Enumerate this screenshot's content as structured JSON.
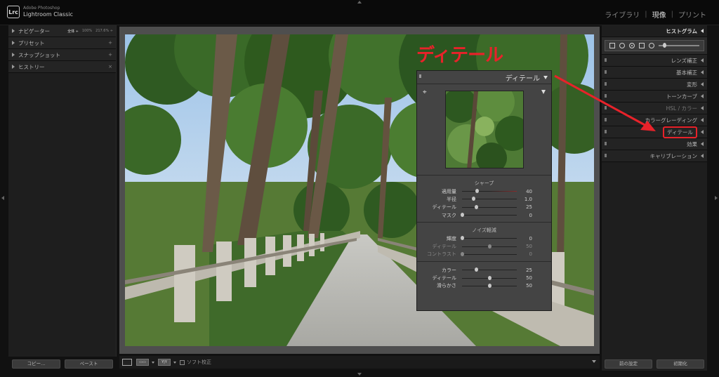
{
  "app": {
    "brand_line1": "Adobe Photoshop",
    "brand_line2": "Lightroom Classic",
    "logo": "Lrc"
  },
  "modules": {
    "library": "ライブラリ",
    "develop": "現像",
    "print": "プリント"
  },
  "left_panel": {
    "navigator": {
      "label": "ナビゲーター",
      "fit": "全体 ÷",
      "zoom1": "100%",
      "zoom2": "217.6% ÷"
    },
    "items": [
      {
        "label": "プリセット",
        "action": "+"
      },
      {
        "label": "スナップショット",
        "action": "+"
      },
      {
        "label": "ヒストリー",
        "action": "×"
      }
    ],
    "copy_button": "コピー...",
    "paste_button": "ペースト"
  },
  "toolbar": {
    "softproof_label": "ソフト校正",
    "box1": "▭▭",
    "box2": "Y|Y"
  },
  "right_panel": {
    "histogram": "ヒストグラム",
    "panels": [
      {
        "label": "レンズ補正"
      },
      {
        "label": "基本補正"
      },
      {
        "label": "変形"
      },
      {
        "label": "トーンカーブ"
      },
      {
        "label": "HSL / カラー"
      },
      {
        "label": "カラーグレーディング"
      },
      {
        "label": "ディテール"
      },
      {
        "label": "効果"
      },
      {
        "label": "キャリブレーション"
      }
    ],
    "highlighted": "ディテール",
    "prev_button": "前の設定",
    "reset_button": "初期化"
  },
  "annotation": {
    "title": "ディテール",
    "color": "#e8222a"
  },
  "detail_panel": {
    "title": "ディテール",
    "sharpen": {
      "title": "シャープ",
      "rows": [
        {
          "label": "適用量",
          "value": "40",
          "pos": 0.27
        },
        {
          "label": "半径",
          "value": "1.0",
          "pos": 0.2
        },
        {
          "label": "ディテール",
          "value": "25",
          "pos": 0.25
        },
        {
          "label": "マスク",
          "value": "0",
          "pos": 0.0
        }
      ]
    },
    "noise": {
      "title": "ノイズ軽減",
      "rows": [
        {
          "label": "輝度",
          "value": "0",
          "pos": 0.0
        },
        {
          "label": "ディテール",
          "value": "50",
          "pos": 0.5
        },
        {
          "label": "コントラスト",
          "value": "0",
          "pos": 0.0
        }
      ]
    },
    "color": {
      "rows": [
        {
          "label": "カラー",
          "value": "25",
          "pos": 0.25
        },
        {
          "label": "ディテール",
          "value": "50",
          "pos": 0.5
        },
        {
          "label": "滑らかさ",
          "value": "50",
          "pos": 0.5
        }
      ]
    }
  }
}
